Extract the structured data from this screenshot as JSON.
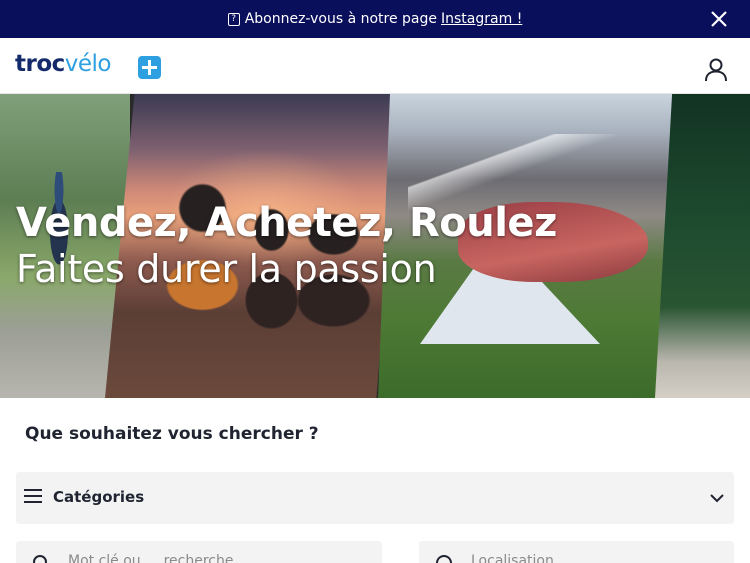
{
  "announcement": {
    "text": "Abonnez-vous à notre page ",
    "link": "Instagram !",
    "icon": "question-box-icon",
    "close_icon": "close-icon"
  },
  "header": {
    "logo_part1": "troc",
    "logo_part2": "vélo",
    "plus_icon": "plus-icon",
    "account_icon": "user-icon"
  },
  "hero": {
    "title": "Vendez, Achetez, Roulez",
    "subtitle": "Faites durer la passion"
  },
  "search": {
    "heading": "Que souhaitez vous chercher ?",
    "categories_label": "Catégories",
    "categories_icon": "menu-icon",
    "categories_chevron": "chevron-down-icon",
    "keyword_placeholder": "Mot clé ou … recherche",
    "location_placeholder": "Localisation"
  },
  "colors": {
    "announcement_bg": "#0a0f5c",
    "brand_dark": "#142a6b",
    "brand_accent": "#2e9fe0",
    "field_bg": "#f3f3f3"
  }
}
